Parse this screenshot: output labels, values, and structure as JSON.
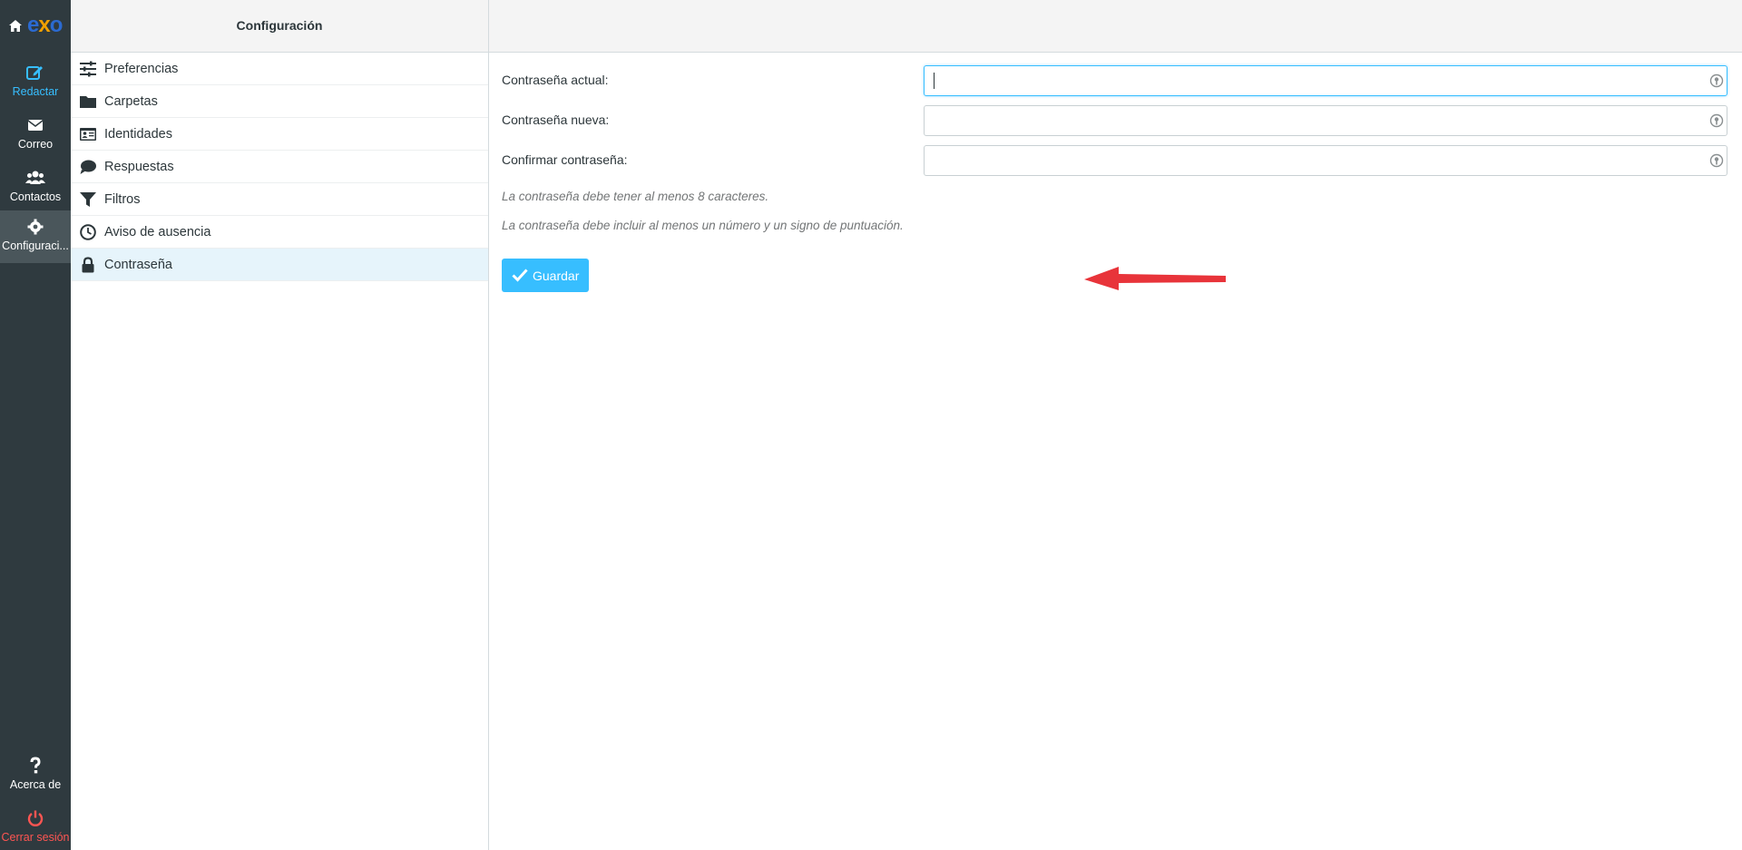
{
  "app": {
    "title": "Configuración",
    "logo": {
      "part1": "e",
      "part2": "x",
      "part3": "o"
    }
  },
  "nav": {
    "compose": "Redactar",
    "mail": "Correo",
    "contacts": "Contactos",
    "settings": "Configuraci...",
    "about": "Acerca de",
    "logout": "Cerrar sesión"
  },
  "settings_list": {
    "header": "Configuración",
    "items": [
      {
        "label": "Preferencias",
        "icon": "sliders-icon"
      },
      {
        "label": "Carpetas",
        "icon": "folder-icon"
      },
      {
        "label": "Identidades",
        "icon": "id-card-icon"
      },
      {
        "label": "Respuestas",
        "icon": "comment-icon"
      },
      {
        "label": "Filtros",
        "icon": "filter-icon"
      },
      {
        "label": "Aviso de ausencia",
        "icon": "clock-icon"
      },
      {
        "label": "Contraseña",
        "icon": "lock-icon",
        "selected": true
      }
    ]
  },
  "password_form": {
    "current_label": "Contraseña actual:",
    "new_label": "Contraseña nueva:",
    "confirm_label": "Confirmar contraseña:",
    "current_value": "",
    "new_value": "",
    "confirm_value": "",
    "hint1": "La contraseña debe tener al menos 8 caracteres.",
    "hint2": "La contraseña debe incluir al menos un número y un signo de puntuación.",
    "save_label": "Guardar"
  },
  "colors": {
    "accent": "#37beff",
    "nav_bg": "#2f3a3f",
    "logout": "#ff5552",
    "selected_bg": "#e6f4fb",
    "annotation_arrow": "#e8343a"
  }
}
